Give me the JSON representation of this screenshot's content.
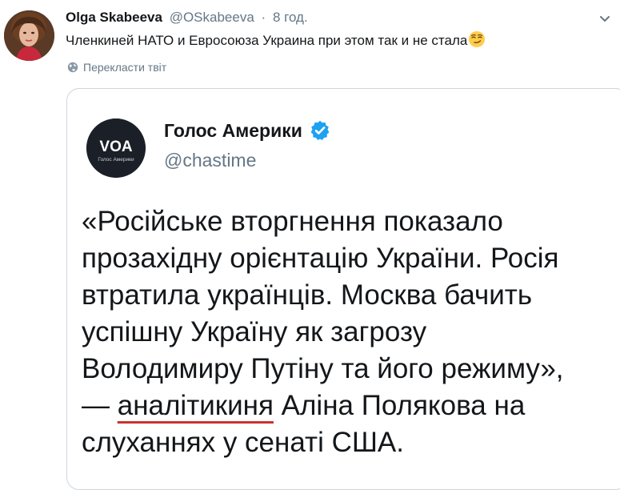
{
  "tweet": {
    "author_name": "Olga Skabeeva",
    "author_handle": "@OSkabeeva",
    "separator": "·",
    "time": "8 год.",
    "text": "Членкиней НАТО и Евросоюза Украина при этом так и не стала",
    "emoji": "smirking-face",
    "translate_label": "Перекласти твіт"
  },
  "quoted": {
    "name": "Голос Америки",
    "handle": "@chastime",
    "logo_text": "VOA",
    "logo_subtext": "Голос Америки",
    "verified": true,
    "lines": [
      "«Російське вторгнення показало",
      "прозахідну орієнтацію України. Росія",
      "втратила українців. Москва бачить",
      "успішну Україну як загрозу",
      "Володимиру Путіну та його режиму»,"
    ],
    "line6_prefix": "— ",
    "line6_underlined": "аналітикиня",
    "line6_suffix": " Аліна Полякова на",
    "line7": "слуханнях у сенаті США."
  },
  "colors": {
    "accent": "#1da1f2",
    "underline": "#c9332e",
    "muted": "#657786",
    "border": "#ccd6dd"
  }
}
